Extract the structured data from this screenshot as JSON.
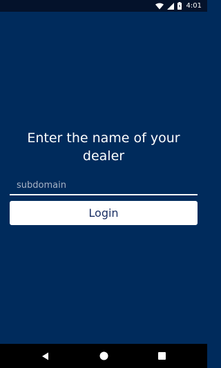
{
  "status_bar": {
    "time": "4:01",
    "icons": [
      "wifi-icon",
      "signal-icon",
      "battery-icon"
    ]
  },
  "main": {
    "title": "Enter the name of your dealer",
    "subdomain_placeholder": "subdomain",
    "subdomain_value": "",
    "login_label": "Login"
  },
  "nav_bar": {
    "buttons": [
      "back-icon",
      "home-icon",
      "recents-icon"
    ]
  },
  "colors": {
    "background": "#002b5c",
    "status_bar": "#04122b",
    "button_bg": "#ffffff",
    "button_text": "#1a2f63"
  }
}
